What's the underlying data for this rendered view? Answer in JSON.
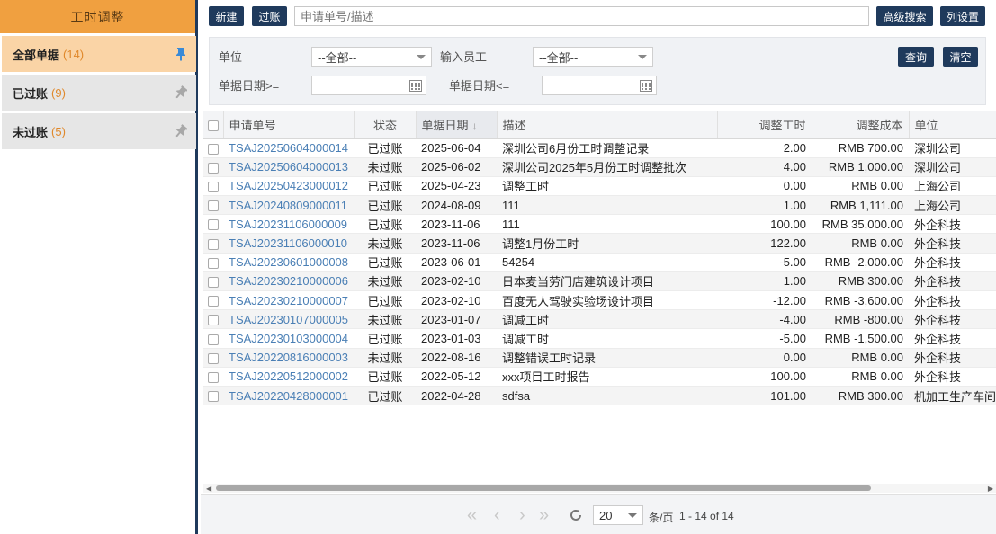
{
  "sidebar": {
    "title": "工时调整",
    "items": [
      {
        "label": "全部单据",
        "count": "(14)",
        "active": true
      },
      {
        "label": "已过账",
        "count": "(9)",
        "active": false
      },
      {
        "label": "未过账",
        "count": "(5)",
        "active": false
      }
    ]
  },
  "toolbar": {
    "new_label": "新建",
    "post_label": "过账",
    "search_placeholder": "申请单号/描述",
    "advanced_search_label": "高级搜索",
    "column_settings_label": "列设置"
  },
  "filters": {
    "unit_label": "单位",
    "unit_value": "--全部--",
    "employee_label": "输入员工",
    "employee_value": "--全部--",
    "date_from_label": "单据日期>=",
    "date_to_label": "单据日期<=",
    "query_label": "查询",
    "clear_label": "清空"
  },
  "table": {
    "columns": [
      "申请单号",
      "状态",
      "单据日期",
      "描述",
      "调整工时",
      "调整成本",
      "单位"
    ],
    "sort_indicator": "↓",
    "rows": [
      [
        "TSAJ20250604000014",
        "已过账",
        "2025-06-04",
        "深圳公司6月份工时调整记录",
        "2.00",
        "RMB 700.00",
        "深圳公司"
      ],
      [
        "TSAJ20250604000013",
        "未过账",
        "2025-06-02",
        "深圳公司2025年5月份工时调整批次",
        "4.00",
        "RMB 1,000.00",
        "深圳公司"
      ],
      [
        "TSAJ20250423000012",
        "已过账",
        "2025-04-23",
        "调整工时",
        "0.00",
        "RMB 0.00",
        "上海公司"
      ],
      [
        "TSAJ20240809000011",
        "已过账",
        "2024-08-09",
        "111",
        "1.00",
        "RMB 1,111.00",
        "上海公司"
      ],
      [
        "TSAJ20231106000009",
        "已过账",
        "2023-11-06",
        "111",
        "100.00",
        "RMB 35,000.00",
        "外企科技"
      ],
      [
        "TSAJ20231106000010",
        "未过账",
        "2023-11-06",
        "调整1月份工时",
        "122.00",
        "RMB 0.00",
        "外企科技"
      ],
      [
        "TSAJ20230601000008",
        "已过账",
        "2023-06-01",
        "54254",
        "-5.00",
        "RMB -2,000.00",
        "外企科技"
      ],
      [
        "TSAJ20230210000006",
        "未过账",
        "2023-02-10",
        "日本麦当劳门店建筑设计项目",
        "1.00",
        "RMB 300.00",
        "外企科技"
      ],
      [
        "TSAJ20230210000007",
        "已过账",
        "2023-02-10",
        "百度无人驾驶实验场设计项目",
        "-12.00",
        "RMB -3,600.00",
        "外企科技"
      ],
      [
        "TSAJ20230107000005",
        "未过账",
        "2023-01-07",
        "调减工时",
        "-4.00",
        "RMB -800.00",
        "外企科技"
      ],
      [
        "TSAJ20230103000004",
        "已过账",
        "2023-01-03",
        "调减工时",
        "-5.00",
        "RMB -1,500.00",
        "外企科技"
      ],
      [
        "TSAJ20220816000003",
        "未过账",
        "2022-08-16",
        "调整错误工时记录",
        "0.00",
        "RMB 0.00",
        "外企科技"
      ],
      [
        "TSAJ20220512000002",
        "已过账",
        "2022-05-12",
        "xxx项目工时报告",
        "100.00",
        "RMB 0.00",
        "外企科技"
      ],
      [
        "TSAJ20220428000001",
        "已过账",
        "2022-04-28",
        "sdfsa",
        "101.00",
        "RMB 300.00",
        "机加工生产车间"
      ]
    ]
  },
  "pager": {
    "page_size": "20",
    "per_page_label": "条/页",
    "range_text": "1 - 14 of 14"
  }
}
